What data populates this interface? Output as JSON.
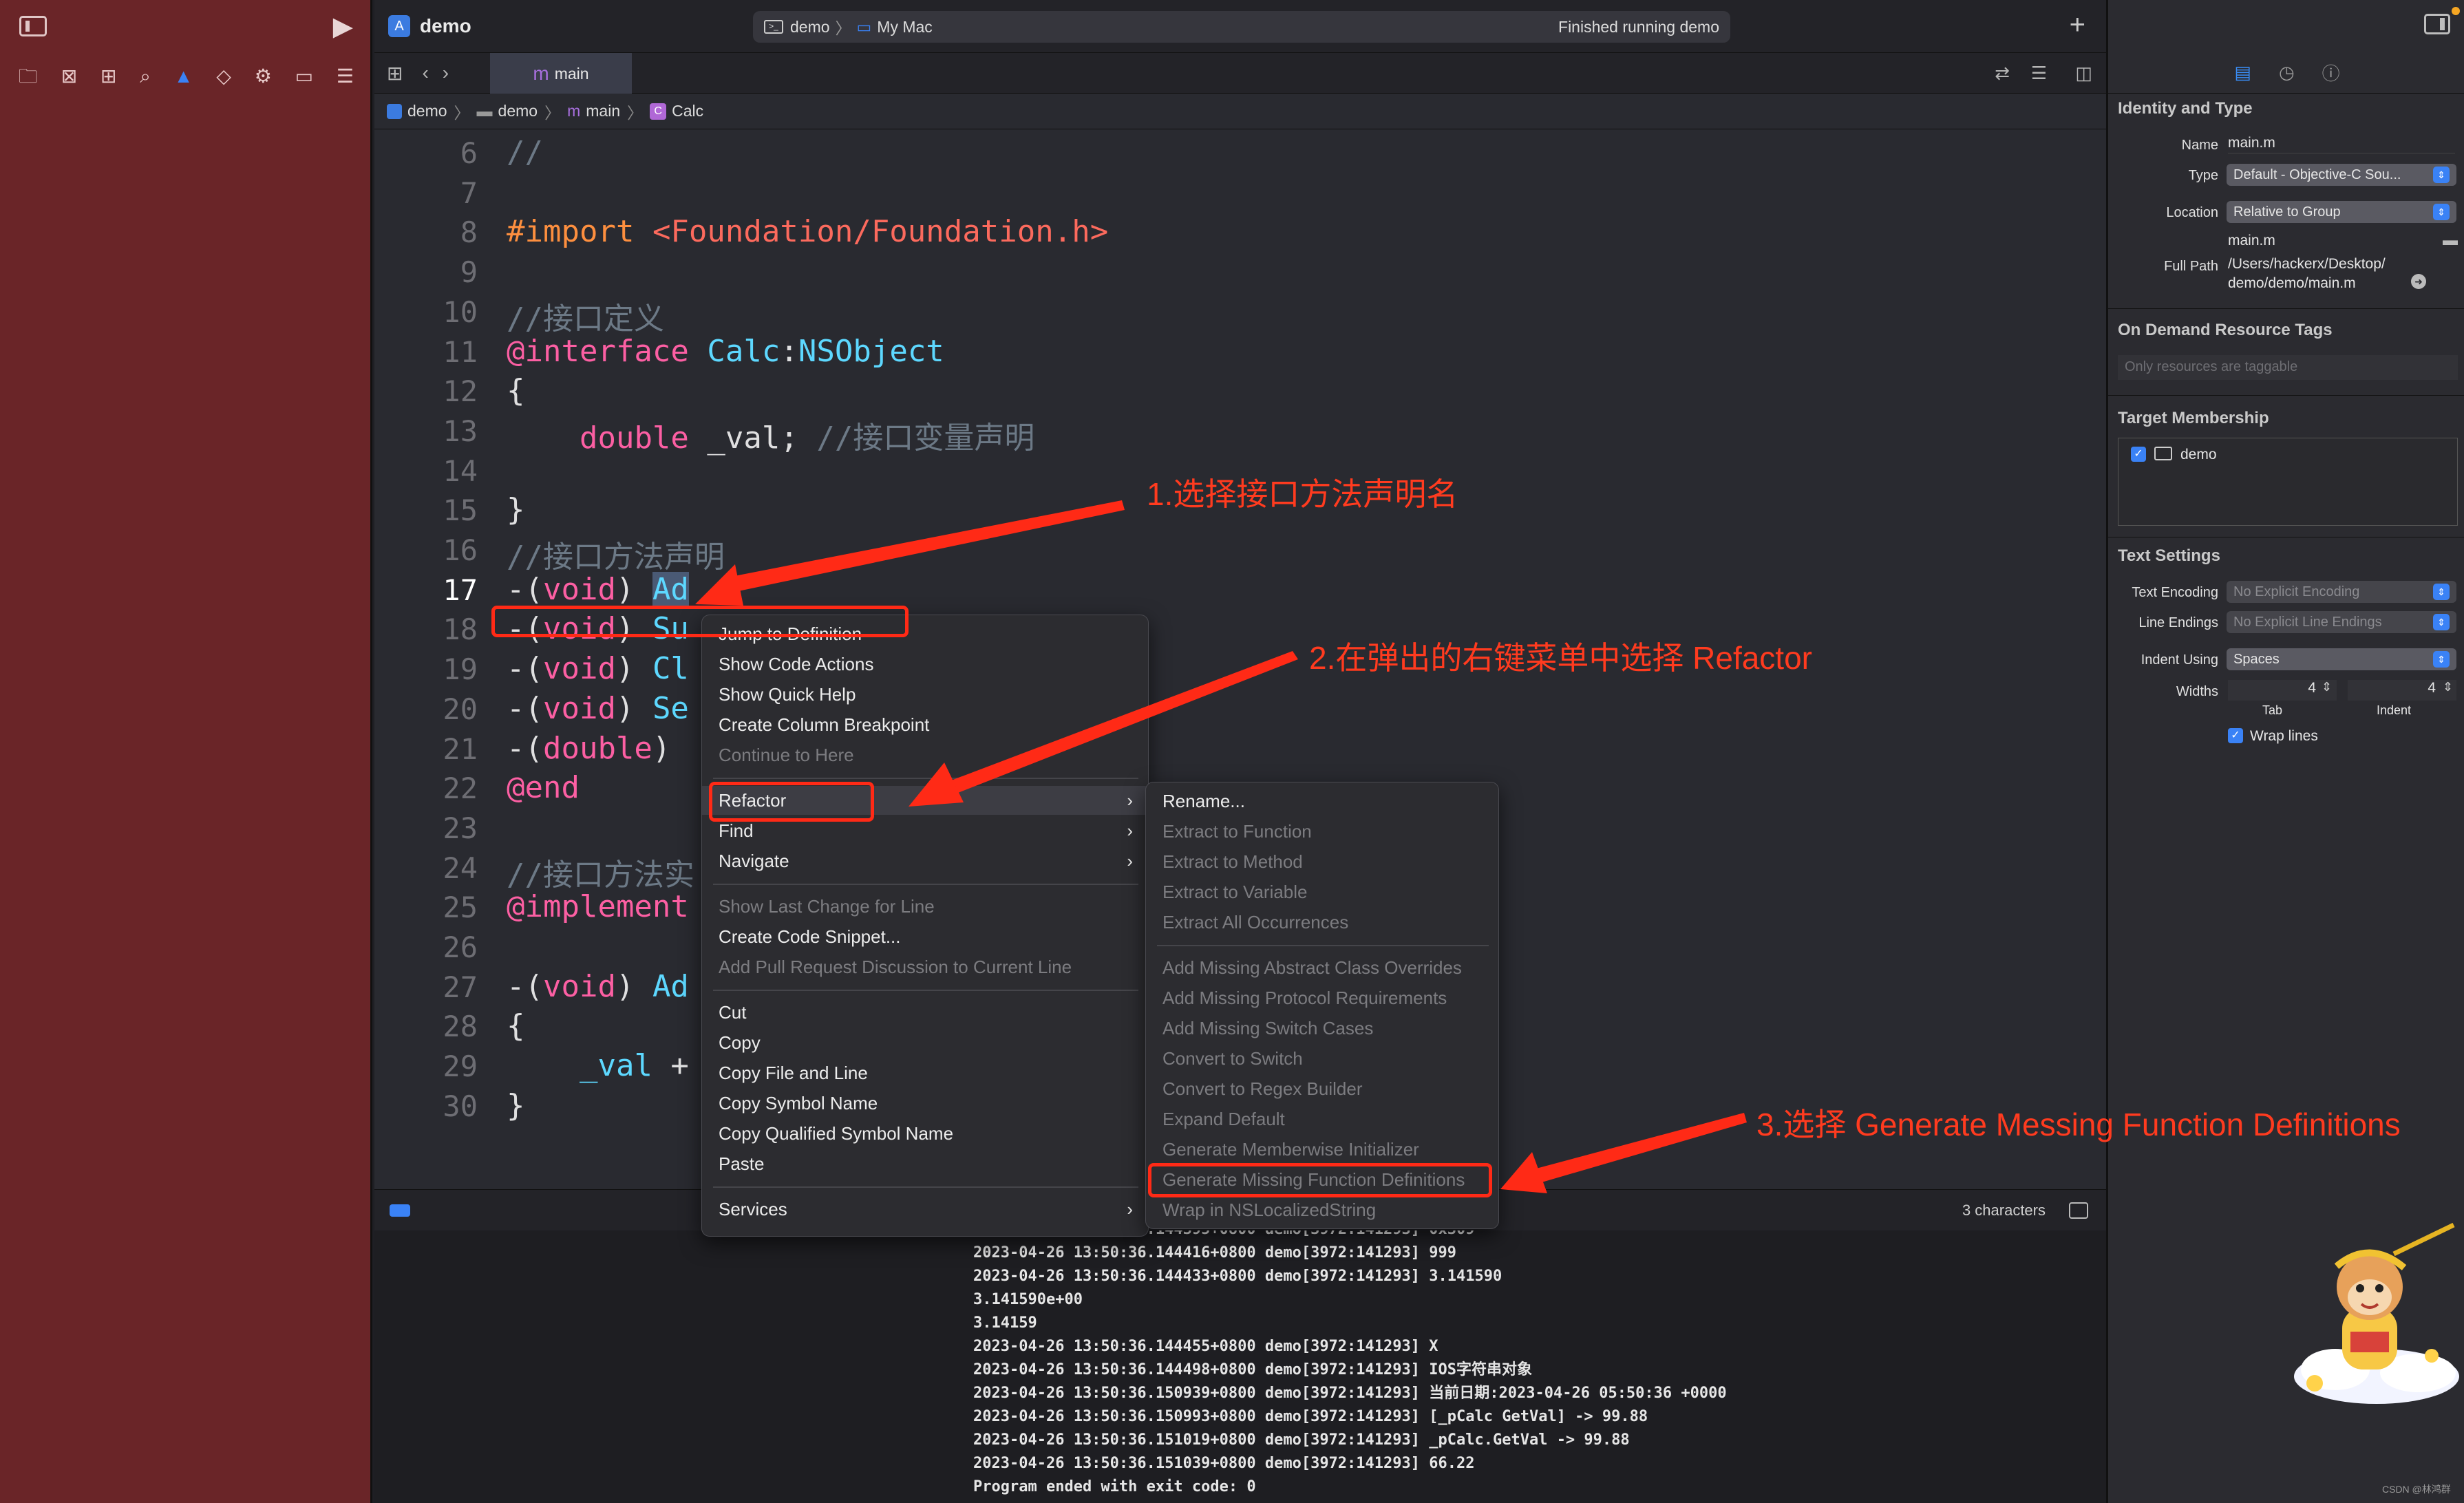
{
  "window": {
    "title": "demo",
    "scheme_target": "demo",
    "scheme_device": "My Mac",
    "status": "Finished running demo"
  },
  "tab": {
    "label": "main"
  },
  "breadcrumb": [
    "demo",
    "demo",
    "main",
    "Calc"
  ],
  "code_lines": [
    {
      "n": "6",
      "html": "<span class=\"cm\">//</span>"
    },
    {
      "n": "7",
      "html": ""
    },
    {
      "n": "8",
      "html": "<span class=\"pp\">#import</span> <span class=\"str\">&lt;Foundation/Foundation.h&gt;</span>"
    },
    {
      "n": "9",
      "html": ""
    },
    {
      "n": "10",
      "html": "<span class=\"cm\">//接口定义</span>"
    },
    {
      "n": "11",
      "html": "<span class=\"kw\">@interface</span> <span class=\"ty\">Calc</span>:<span class=\"ty\">NSObject</span>"
    },
    {
      "n": "12",
      "html": "{"
    },
    {
      "n": "13",
      "html": "    <span class=\"kw\">double</span> _val; <span class=\"cm\">//接口变量声明</span>"
    },
    {
      "n": "14",
      "html": ""
    },
    {
      "n": "15",
      "html": "}"
    },
    {
      "n": "16",
      "html": "<span class=\"cm\">//接口方法声明</span>"
    },
    {
      "n": "17",
      "html": "-(<span class=\"kw\">void</span>) <span class=\"sel\">Ad</span>"
    },
    {
      "n": "18",
      "html": "-(<span class=\"kw\">void</span>) <span class=\"ty\">Su</span>"
    },
    {
      "n": "19",
      "html": "-(<span class=\"kw\">void</span>) <span class=\"ty\">Cl</span>"
    },
    {
      "n": "20",
      "html": "-(<span class=\"kw\">void</span>) <span class=\"ty\">Se</span>"
    },
    {
      "n": "21",
      "html": "-(<span class=\"kw\">double</span>)"
    },
    {
      "n": "22",
      "html": "<span class=\"kw\">@end</span>"
    },
    {
      "n": "23",
      "html": ""
    },
    {
      "n": "24",
      "html": "<span class=\"cm\">//接口方法实</span>"
    },
    {
      "n": "25",
      "html": "<span class=\"kw\">@implement</span>"
    },
    {
      "n": "26",
      "html": ""
    },
    {
      "n": "27",
      "html": "-(<span class=\"kw\">void</span>) <span class=\"ty\">Ad</span>"
    },
    {
      "n": "28",
      "html": "{"
    },
    {
      "n": "29",
      "html": "    <span class=\"ty\">_val</span> +"
    },
    {
      "n": "30",
      "html": "}"
    }
  ],
  "context_menu": {
    "items": [
      {
        "label": "Jump to Definition",
        "disabled": false
      },
      {
        "label": "Show Code Actions",
        "disabled": false
      },
      {
        "label": "Show Quick Help",
        "disabled": false
      },
      {
        "label": "Create Column Breakpoint",
        "disabled": false
      },
      {
        "label": "Continue to Here",
        "disabled": true
      },
      {
        "sep": true
      },
      {
        "label": "Refactor",
        "disabled": false,
        "submenu": true
      },
      {
        "label": "Find",
        "disabled": false,
        "submenu": true
      },
      {
        "label": "Navigate",
        "disabled": false,
        "submenu": true
      },
      {
        "sep": true
      },
      {
        "label": "Show Last Change for Line",
        "disabled": true
      },
      {
        "label": "Create Code Snippet...",
        "disabled": false
      },
      {
        "label": "Add Pull Request Discussion to Current Line",
        "disabled": true
      },
      {
        "sep": true
      },
      {
        "label": "Cut",
        "disabled": false
      },
      {
        "label": "Copy",
        "disabled": false
      },
      {
        "label": "Copy File and Line",
        "disabled": false
      },
      {
        "label": "Copy Symbol Name",
        "disabled": false
      },
      {
        "label": "Copy Qualified Symbol Name",
        "disabled": false
      },
      {
        "label": "Paste",
        "disabled": false
      },
      {
        "sep": true
      },
      {
        "label": "Services",
        "disabled": false,
        "submenu": true
      }
    ]
  },
  "refactor_menu": {
    "items": [
      {
        "label": "Rename...",
        "disabled": false
      },
      {
        "label": "Extract to Function",
        "disabled": true
      },
      {
        "label": "Extract to Method",
        "disabled": true
      },
      {
        "label": "Extract to Variable",
        "disabled": true
      },
      {
        "label": "Extract All Occurrences",
        "disabled": true
      },
      {
        "sep": true
      },
      {
        "label": "Add Missing Abstract Class Overrides",
        "disabled": true
      },
      {
        "label": "Add Missing Protocol Requirements",
        "disabled": true
      },
      {
        "label": "Add Missing Switch Cases",
        "disabled": true
      },
      {
        "label": "Convert to Switch",
        "disabled": true
      },
      {
        "label": "Convert to Regex Builder",
        "disabled": true
      },
      {
        "label": "Expand Default",
        "disabled": true
      },
      {
        "label": "Generate Memberwise Initializer",
        "disabled": true
      },
      {
        "label": "Generate Missing Function Definitions",
        "disabled": true
      },
      {
        "label": "Wrap in NSLocalizedString",
        "disabled": true
      }
    ]
  },
  "status": {
    "chars": "3 characters"
  },
  "console_lines": [
    "2023-04-26 13:50:36.144395+0800 demo[3972:141293] 0x309",
    "2023-04-26 13:50:36.144416+0800 demo[3972:141293] 999",
    "2023-04-26 13:50:36.144433+0800 demo[3972:141293] 3.141590",
    "3.141590e+00",
    "3.14159",
    "2023-04-26 13:50:36.144455+0800 demo[3972:141293] X",
    "2023-04-26 13:50:36.144498+0800 demo[3972:141293] IOS字符串对象",
    "2023-04-26 13:50:36.150939+0800 demo[3972:141293] 当前日期:2023-04-26 05:50:36 +0000",
    "2023-04-26 13:50:36.150993+0800 demo[3972:141293] [_pCalc GetVal] -> 99.88",
    "2023-04-26 13:50:36.151019+0800 demo[3972:141293] _pCalc.GetVal -> 99.88",
    "2023-04-26 13:50:36.151039+0800 demo[3972:141293] 66.22",
    "Program ended with exit code: 0"
  ],
  "inspector": {
    "identity_title": "Identity and Type",
    "name_label": "Name",
    "name_value": "main.m",
    "type_label": "Type",
    "type_value": "Default - Objective-C Sou...",
    "location_label": "Location",
    "location_value": "Relative to Group",
    "location_file": "main.m",
    "fullpath_label": "Full Path",
    "fullpath_value1": "/Users/hackerx/Desktop/",
    "fullpath_value2": "demo/demo/main.m",
    "odr_title": "On Demand Resource Tags",
    "odr_placeholder": "Only resources are taggable",
    "membership_title": "Target Membership",
    "membership_item": "demo",
    "text_title": "Text Settings",
    "encoding_label": "Text Encoding",
    "encoding_value": "No Explicit Encoding",
    "endings_label": "Line Endings",
    "endings_value": "No Explicit Line Endings",
    "indent_label": "Indent Using",
    "indent_value": "Spaces",
    "widths_label": "Widths",
    "tab_width": "4",
    "indent_width": "4",
    "tab_label": "Tab",
    "indent_caption": "Indent",
    "wrap_label": "Wrap lines",
    "watermark": "CSDN @林鸿群"
  },
  "annotations": {
    "a1": "1.选择接口方法声明名",
    "a2": "2.在弹出的右键菜单中选择 Refactor",
    "a3": "3.选择 Generate Messing Function Definitions"
  },
  "colors": {
    "annotation": "#ff2a16",
    "navigator_bg": "#6a2528",
    "accent": "#3a82f6"
  }
}
